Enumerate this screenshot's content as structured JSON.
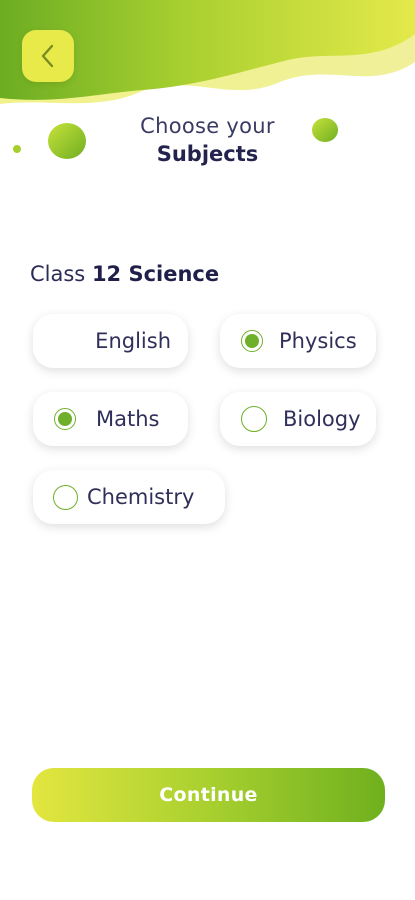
{
  "header": {
    "back_icon": "chevron-left-icon",
    "title_line1": "Choose your",
    "title_line2": "Subjects"
  },
  "class_info": {
    "prefix": "Class",
    "name": "12 Science"
  },
  "subjects": [
    {
      "label": "English",
      "selected": false,
      "radio_visible": false
    },
    {
      "label": "Physics",
      "selected": true,
      "radio_visible": true
    },
    {
      "label": "Maths",
      "selected": true,
      "radio_visible": true
    },
    {
      "label": "Biology",
      "selected": false,
      "radio_visible": true
    },
    {
      "label": "Chemistry",
      "selected": false,
      "radio_visible": true
    }
  ],
  "continue_label": "Continue",
  "colors": {
    "accent_green": "#6fb02a",
    "accent_yellow": "#e7ea48",
    "text_navy": "#262650"
  }
}
